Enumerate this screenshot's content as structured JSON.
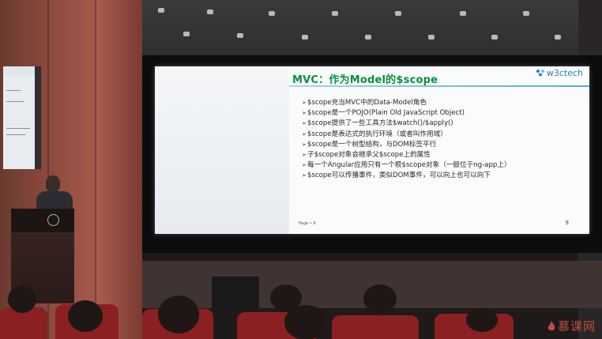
{
  "slide": {
    "title": "MVC：作为Model的$scope",
    "logo_text": "w3ctech",
    "bullets": [
      "$scope充当MVC中的Data-Model角色",
      "$scope是一个POJO(Plain Old JavaScript Object)",
      "$scope提供了一些工具方法$watch()/$apply()",
      "$scope是表达式的执行环境（或者叫作用域）",
      "$scope是一个树型结构，与DOM标签平行",
      "子$scope对象会继承父$scope上的属性",
      "每一个Angular应用只有一个根$scope对象（一般位于ng-app上）",
      "$scope可以传播事件，类似DOM事件，可以向上也可以向下"
    ],
    "bullet_marker": "➢",
    "footer_left": "Page • 9",
    "page_number": "9"
  },
  "watermark": "慕课网",
  "colors": {
    "title_green": "#0b8f3f",
    "logo_blue": "#2c7fb8",
    "seat_red": "#8a2022",
    "wall_brown": "#8c4a3e"
  },
  "icons": {
    "logo": "w3ctech-logo",
    "watermark": "flame-icon"
  }
}
